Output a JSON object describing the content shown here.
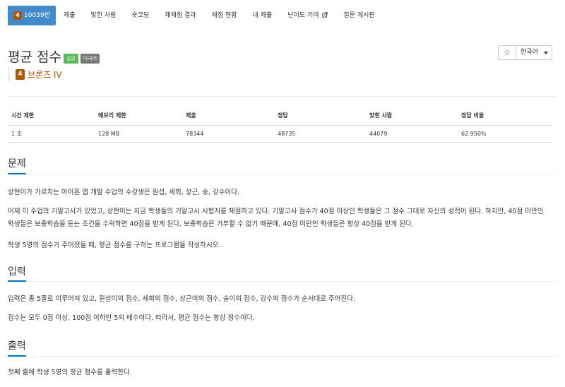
{
  "tabs": {
    "problem_badge": "4",
    "problem_number": "10039번",
    "items": [
      "제출",
      "맞힌 사람",
      "숏코딩",
      "재채점 결과",
      "채점 현황",
      "내 제출",
      "난이도 기여",
      "질문 게시판"
    ]
  },
  "problem": {
    "title": "평균 점수",
    "labels": [
      "성공",
      "다국어"
    ],
    "tier_badge": "4",
    "tier": "브론즈 IV"
  },
  "controls": {
    "star": "☆",
    "language": "한국어"
  },
  "info_table": {
    "headers": [
      "시간 제한",
      "메모리 제한",
      "제출",
      "정답",
      "맞힌 사람",
      "정답 비율"
    ],
    "row": [
      "1 초",
      "128 MB",
      "78344",
      "48735",
      "44079",
      "62.950%"
    ]
  },
  "sections": {
    "description": {
      "title": "문제",
      "paragraphs": [
        "상현이가 가르치는 아이폰 앱 개발 수업의 수강생은 원섭, 세희, 상근, 숭, 강수이다.",
        "어제 이 수업의 기말고사가 있었고, 상현이는 지금 학생들의 기말고사 시험지를 채점하고 있다. 기말고사 점수가 40점 이상인 학생들은 그 점수 그대로 자신의 성적이 된다. 하지만, 40점 미만인 학생들은 보충학습을 듣는 조건을 수락하면 40점을 받게 된다. 보충학습은 거부할 수 없기 때문에, 40점 미만인 학생들은 항상 40점을 받게 된다.",
        "학생 5명의 점수가 주어졌을 때, 평균 점수를 구하는 프로그램을 작성하시오."
      ]
    },
    "input": {
      "title": "입력",
      "paragraphs": [
        "입력은 총 5줄로 이루어져 있고, 원섭이의 점수, 세희의 점수, 상근이의 점수, 숭이의 점수, 강수의 점수가 순서대로 주어진다.",
        "점수는 모두 0점 이상, 100점 이하인 5의 배수이다. 따라서, 평균 점수는 항상 정수이다."
      ]
    },
    "output": {
      "title": "출력",
      "paragraphs": [
        "첫째 줄에 학생 5명의 평균 점수를 출력한다."
      ]
    }
  }
}
